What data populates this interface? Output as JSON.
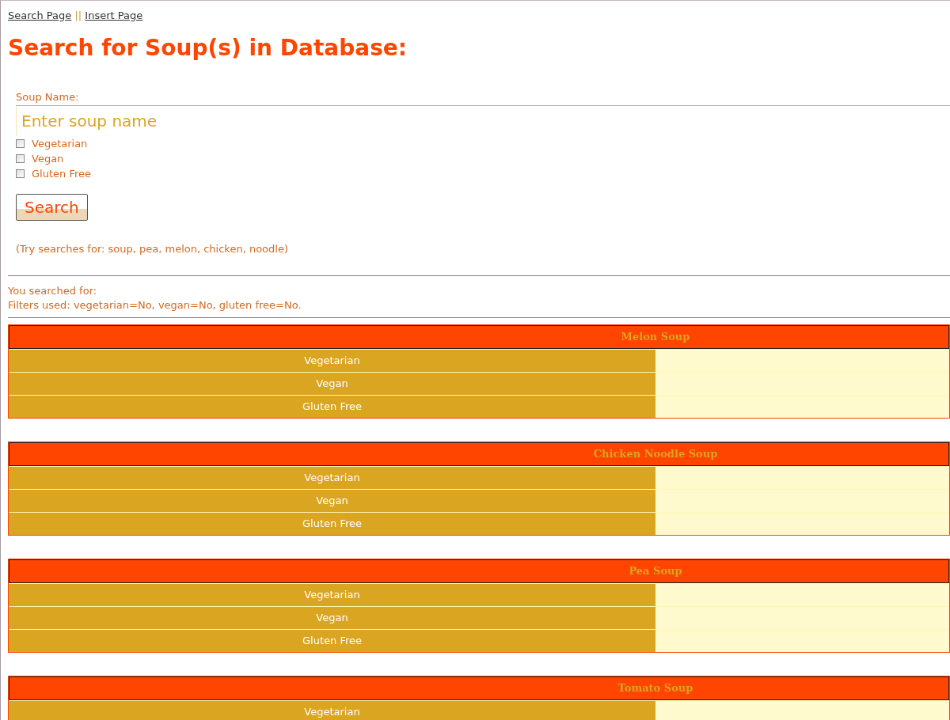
{
  "nav_links": [
    {
      "label": "Search Page"
    },
    {
      "label": "Insert Page"
    }
  ],
  "nav_separator": "||",
  "title": "Search for Soup(s) in Database:",
  "form": {
    "label": "Soup Name:",
    "placeholder": "Enter soup name",
    "filters": [
      {
        "label": "Vegetarian",
        "checked": false
      },
      {
        "label": "Vegan",
        "checked": false
      },
      {
        "label": "Gluten Free",
        "checked": false
      }
    ],
    "button": "Search",
    "hint": "(Try searches for: soup, pea, melon, chicken, noodle)"
  },
  "results": {
    "searched_for": "You searched for:",
    "filters_used": "Filters used: vegetarian=No, vegan=No, gluten free=No.",
    "soups": [
      {
        "name": "Melon Soup",
        "rows": [
          "Vegetarian",
          "Vegan",
          "Gluten Free"
        ]
      },
      {
        "name": "Chicken Noodle Soup",
        "rows": [
          "Vegetarian",
          "Vegan",
          "Gluten Free"
        ]
      },
      {
        "name": "Pea Soup",
        "rows": [
          "Vegetarian",
          "Vegan",
          "Gluten Free"
        ]
      },
      {
        "name": "Tomato Soup",
        "rows": [
          "Vegetarian"
        ]
      }
    ]
  }
}
